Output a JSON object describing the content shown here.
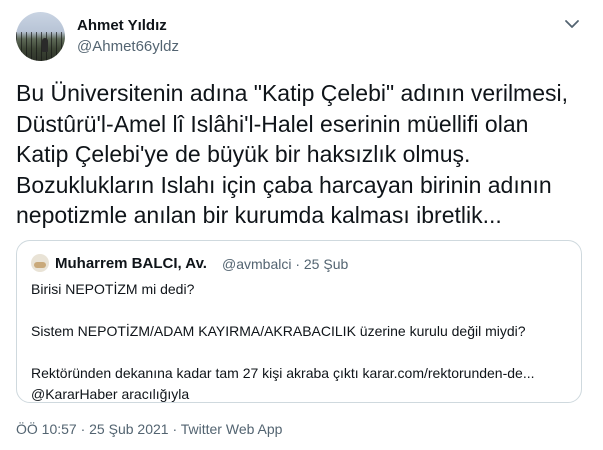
{
  "author": {
    "display_name": "Ahmet Yıldız",
    "handle": "@Ahmet66yldz"
  },
  "tweet": {
    "lines": [
      "Bu Üniversitenin adına \"Katip Çelebi\" adının verilmesi,",
      "Düstûrü'l-Amel lî Islâhi'l-Halel eserinin müellifi olan",
      "Katip Çelebi'ye de büyük bir haksızlık olmuş.",
      "Bozuklukların Islahı için  çaba harcayan birinin adının",
      "nepotizmle anılan bir kurumda kalması ibretlik..."
    ]
  },
  "quoted_tweet": {
    "display_name": "Muharrem BALCI, Av.",
    "meta": "@avmbalci · 25 Şub",
    "lines": {
      "l1": "Birisi NEPOTİZM mi dedi?",
      "l2": "Sistem NEPOTİZM/ADAM KAYIRMA/AKRABACILIK üzerine kurulu değil miydi?",
      "l3": "Rektöründen dekanına kadar tam 27 kişi akraba çıktı karar.com/rektorunden-de...",
      "l4": "@KararHaber aracılığıyla"
    }
  },
  "footer": {
    "meta": "ÖÖ 10:57 · 25 Şub 2021 · Twitter Web App"
  },
  "icons": {
    "caret": "chevron-down-icon"
  },
  "colors": {
    "text_primary": "#0f1419",
    "text_secondary": "#536471",
    "border": "#cfd9de"
  }
}
